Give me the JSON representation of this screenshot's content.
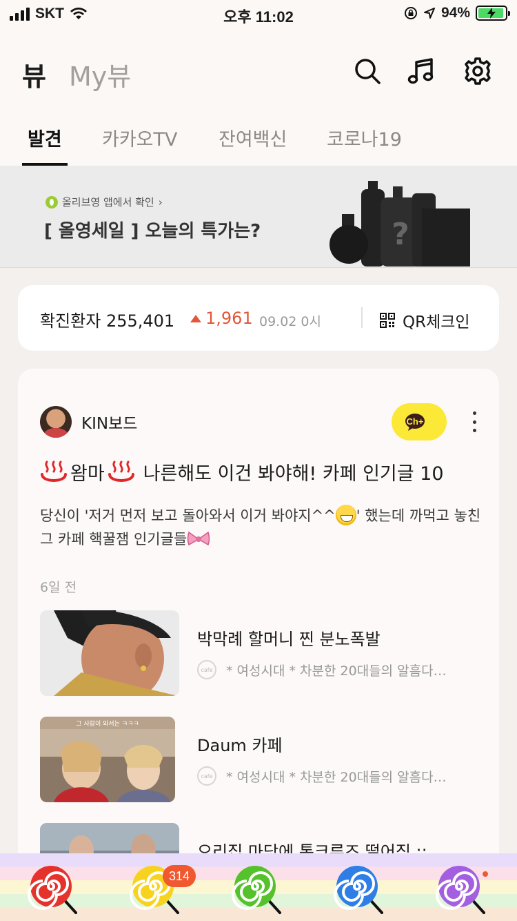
{
  "status_bar": {
    "carrier": "SKT",
    "time": "오후 11:02",
    "battery_pct": "94%",
    "battery_level": 0.94
  },
  "header": {
    "title": "뷰",
    "subtitle": "My뷰",
    "icons": [
      "search-icon",
      "music-icon",
      "settings-icon"
    ]
  },
  "tabs": [
    "발견",
    "카카오TV",
    "잔여백신",
    "코로나19"
  ],
  "banner": {
    "small_text": "올리브영 앱에서 확인",
    "chevron": "›",
    "title": "[ 올영세일 ] 오늘의 특가는?",
    "question_mark": "?"
  },
  "covid": {
    "label": "확진환자 255,401",
    "increase": "1,961",
    "date": "09.02 0시",
    "qr_label": "QR체크인"
  },
  "card": {
    "author": "KIN보드",
    "channel_button": "Ch+",
    "title_prefix": "♨",
    "title_word": "왐마",
    "title_rest": "나른해도 이건 봐야해! 카페 인기글 10",
    "desc_part1": "당신이 '저거 먼저 보고 돌아와서 이거 봐야지^^",
    "desc_part2": "' 했는데 까먹고 놓친 그 카페 핵꿀잼 인기글들",
    "desc_emoji_end": "🎀",
    "time": "6일 전",
    "items": [
      {
        "title": "박막례 할머니 찐 분노폭발",
        "source": "* 여성시대 *  차분한 20대들의 알흠다…"
      },
      {
        "title": "Daum 카페",
        "source": "* 여성시대 *  차분한 20대들의 알흠다…",
        "thumb_caption": "그 사람이 와서는 ㅋㅋㅋ"
      },
      {
        "title": "으리집 마당에 톰크루즈 떨어짐 ::",
        "source": ""
      }
    ],
    "cafe_icon_label": "cafe"
  },
  "tabbar": {
    "items": [
      "lollipop-red",
      "lollipop-yellow",
      "lollipop-green",
      "lollipop-blue",
      "lollipop-purple"
    ],
    "badge": "314",
    "colors": [
      "#e5322d",
      "#f7d320",
      "#55c12b",
      "#2f7ee6",
      "#a45fe0"
    ]
  }
}
